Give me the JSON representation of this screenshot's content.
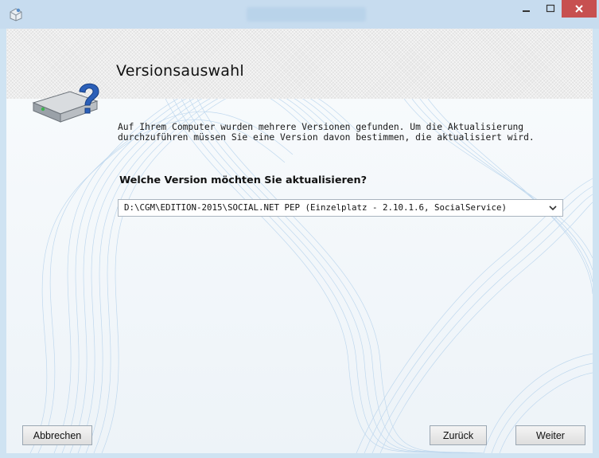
{
  "window": {
    "close_glyph": "✕",
    "minimize_glyph": "–",
    "maximize_glyph": "□"
  },
  "header": {
    "title": "Versionsauswahl",
    "icon": "drive-question-icon"
  },
  "content": {
    "description_line1": "Auf Ihrem Computer wurden mehrere Versionen gefunden. Um die Aktualisierung",
    "description_line2": "durchzuführen müssen Sie eine Version davon bestimmen, die aktualisiert wird.",
    "question": "Welche Version möchten Sie aktualisieren?",
    "version_select": {
      "selected": "D:\\CGM\\EDITION-2015\\SOCIAL.NET PEP (Einzelplatz - 2.10.1.6, SocialService)"
    }
  },
  "buttons": {
    "cancel_label": "Abbrechen",
    "back_label": "Zurück",
    "next_label": "Weiter"
  },
  "colors": {
    "close_red": "#c75050",
    "titlebar": "#c7dcef",
    "wave_blue": "#b3d1ec"
  }
}
